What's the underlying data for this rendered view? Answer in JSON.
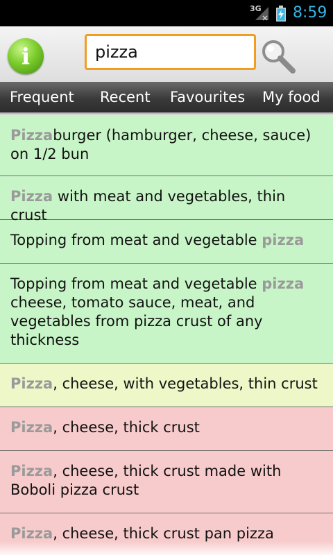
{
  "status_bar": {
    "network": "3G",
    "time": "8:59",
    "colors": {
      "clock": "#33b5e5",
      "background": "#000000"
    }
  },
  "search": {
    "value": "pizza",
    "border_color": "#f39c22"
  },
  "icons": {
    "info": "info-icon",
    "search": "search-icon",
    "signal": "signal-icon",
    "battery": "battery-charging-icon"
  },
  "info_label": "i",
  "tabs": [
    "Frequent",
    "Recent",
    "Favourites",
    "My food"
  ],
  "colors": {
    "green": "#c8f5c8",
    "yellow": "#eef7c8",
    "red": "#f7cbcb",
    "highlight": "#9a9a9a"
  },
  "results": [
    {
      "segments": [
        {
          "text": "Pizza",
          "highlight": true
        },
        {
          "text": "burger (hamburger, cheese, sauce) on 1/2 bun",
          "highlight": false
        }
      ],
      "color": "green"
    },
    {
      "segments": [
        {
          "text": "Pizza",
          "highlight": true
        },
        {
          "text": " with meat and vegetables, thin crust",
          "highlight": false
        }
      ],
      "color": "green"
    },
    {
      "segments": [
        {
          "text": "Topping from meat and vegetable ",
          "highlight": false
        },
        {
          "text": "pizza",
          "highlight": true
        }
      ],
      "color": "green"
    },
    {
      "segments": [
        {
          "text": "Topping from meat and vegetable ",
          "highlight": false
        },
        {
          "text": "pizza",
          "highlight": true
        },
        {
          "text": " cheese, tomato sauce, meat, and vegetables from pizza crust of any thickness",
          "highlight": false
        }
      ],
      "color": "green"
    },
    {
      "segments": [
        {
          "text": "Pizza",
          "highlight": true
        },
        {
          "text": ", cheese, with vegetables, thin crust",
          "highlight": false
        }
      ],
      "color": "yellow"
    },
    {
      "segments": [
        {
          "text": "Pizza",
          "highlight": true
        },
        {
          "text": ", cheese, thick crust",
          "highlight": false
        }
      ],
      "color": "red"
    },
    {
      "segments": [
        {
          "text": "Pizza",
          "highlight": true
        },
        {
          "text": ", cheese, thick crust made with Boboli pizza crust",
          "highlight": false
        }
      ],
      "color": "red"
    },
    {
      "segments": [
        {
          "text": "Pizza",
          "highlight": true
        },
        {
          "text": ", cheese, thick crust pan pizza",
          "highlight": false
        }
      ],
      "color": "red"
    }
  ]
}
